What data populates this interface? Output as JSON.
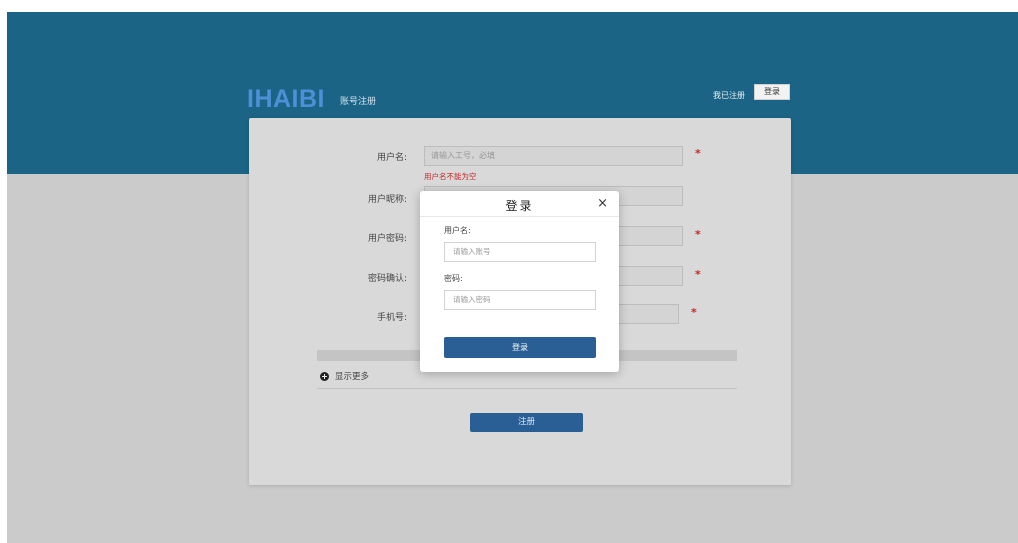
{
  "header": {
    "brand": "IHAIBI",
    "subtitle": "账号注册",
    "already_registered": "我已注册",
    "login_button": "登录"
  },
  "form": {
    "username": {
      "label": "用户名:",
      "placeholder": "请输入工号，必填",
      "required_mark": "*",
      "error": "用户名不能为空"
    },
    "nickname": {
      "label": "用户昵称:"
    },
    "password": {
      "label": "用户密码:",
      "required_mark": "*"
    },
    "password_confirm": {
      "label": "密码确认:",
      "required_mark": "*"
    },
    "phone": {
      "label": "手机号:",
      "required_mark": "*"
    },
    "show_more": "显示更多",
    "register_button": "注册"
  },
  "login_modal": {
    "title": "登录",
    "close": "×",
    "username_label": "用户名:",
    "username_placeholder": "请输入账号",
    "password_label": "密码:",
    "password_placeholder": "请输入密码",
    "submit": "登录"
  },
  "colors": {
    "banner": "#1b6485",
    "brand": "#4c90d6",
    "primary_button": "#2a5f95",
    "error": "#c62828"
  }
}
